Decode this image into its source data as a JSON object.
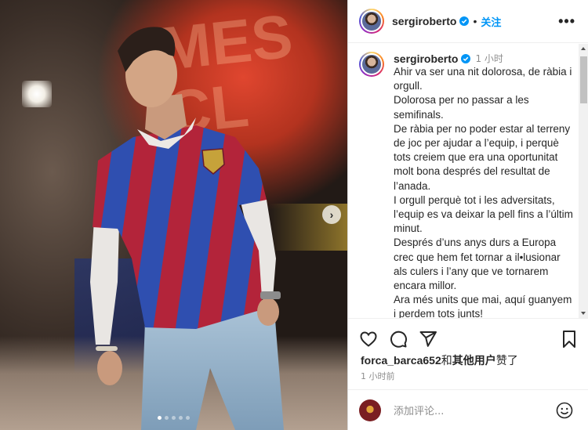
{
  "post": {
    "username": "sergiroberto",
    "follow_label": "关注",
    "more_label": "•••",
    "dot": "•",
    "caption_time": "1 小时",
    "caption": "Ahir va ser una nit dolorosa, de ràbia i orgull.\nDolorosa per no passar a les semifinals.\nDe ràbia per no poder estar al terreny de joc per ajudar a l’equip, i perquè tots creiem que era una oportunitat molt bona després del resultat de l’anada.\nI orgull perquè tot i les adversitats, l’equip es va deixar la pell fins a l’últim minut.\nDesprés d’uns anys durs a Europa crec que hem fet tornar a il•lusionar als culers i l’any que ve tornarem encara millor.\nAra més units que mai, aquí guanyem i perdem tots junts!\nGràcies pel vostre suport afició!\nForça Barça ❤️💙!",
    "likes_user": "forca_barca652",
    "likes_and": "和",
    "likes_others": "其他用户",
    "likes_suffix": "赞了",
    "post_time": "1 小时前",
    "comment_placeholder": "添加评论..."
  },
  "photo": {
    "gallery_next": "›",
    "wall_text": "MES\nCL",
    "dots_total": 5,
    "dots_active": 1
  },
  "colors": {
    "accent": "#0095f6",
    "verified": "#0095f6",
    "jersey_blue": "#2f4fb0",
    "jersey_red": "#b3243a"
  },
  "icons": [
    "heart-icon",
    "comment-icon",
    "share-icon",
    "bookmark-icon",
    "emoji-icon",
    "verified-icon",
    "chevron-right-icon"
  ]
}
